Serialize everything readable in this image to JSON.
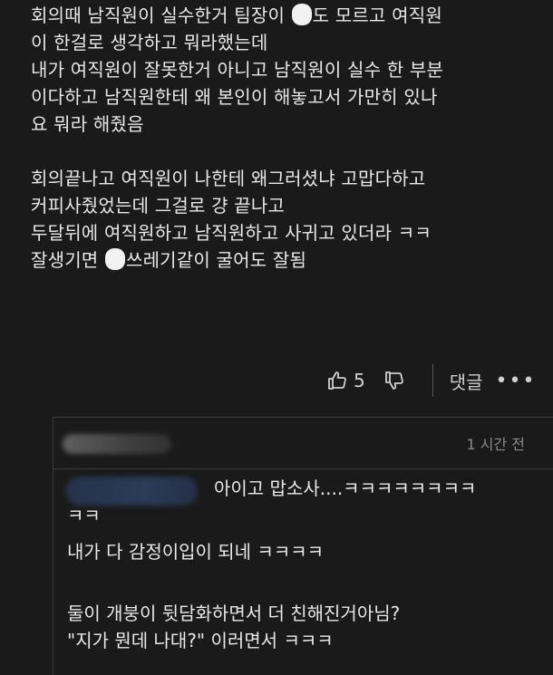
{
  "comment": {
    "line1a": "회의때 남직원이 실수한거 팀장이 ",
    "line1b": "도 모르고 여직원",
    "line2": "이 한걸로 생각하고 뭐라했는데",
    "line3": "내가 여직원이 잘못한거 아니고 남직원이 실수 한 부분",
    "line4": "이다하고 남직원한테 왜 본인이 해놓고서 가만히 있나",
    "line5": "요 뭐라 해줬음",
    "line6": "회의끝나고 여직원이 나한테 왜그러셨냐 고맙다하고",
    "line7": "커피사줬었는데 그걸로 걍 끝나고",
    "line8": "두달뒤에 여직원하고 남직원하고 사귀고 있더라 ㅋㅋ",
    "line9a": "잘생기면 ",
    "line9b": "쓰레기같이 굴어도 잘됨"
  },
  "actions": {
    "like_count": "5",
    "reply_label": "댓글",
    "more_label": "⋮"
  },
  "reply": {
    "time": "1 시간 전",
    "line1": "아이고 맙소사....ㅋㅋㅋㅋㅋㅋㅋㅋ",
    "line2": "ㅋㅋ",
    "line3": "내가 다 감정이입이 되네 ㅋㅋㅋㅋ",
    "line4": "둘이 개붕이 뒷담화하면서 더 친해진거아님?",
    "line5": "\"지가 뭔데 나대?\" 이러면서 ㅋㅋㅋ"
  },
  "icons": {
    "like": "thumbs-up-icon",
    "dislike": "thumbs-down-icon",
    "more": "more-icon"
  }
}
